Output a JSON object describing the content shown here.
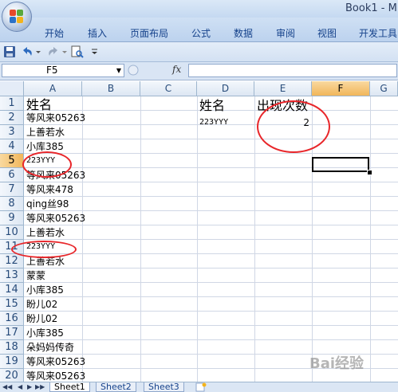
{
  "window": {
    "title": "Book1 - M"
  },
  "ribbon": {
    "tabs": [
      "开始",
      "插入",
      "页面布局",
      "公式",
      "数据",
      "审阅",
      "视图",
      "开发工具"
    ]
  },
  "formula_bar": {
    "name_box": "F5",
    "fx": "fx",
    "content": ""
  },
  "columns": [
    "A",
    "B",
    "C",
    "D",
    "E",
    "F",
    "G"
  ],
  "rows": [
    "1",
    "2",
    "3",
    "4",
    "5",
    "6",
    "7",
    "8",
    "9",
    "10",
    "11",
    "12",
    "13",
    "14",
    "15",
    "16",
    "17",
    "18",
    "19",
    "20"
  ],
  "cells": {
    "A": [
      "姓名",
      "等风来05263",
      "上善若水",
      "小库385",
      "223YYY",
      "等风来05263",
      "等风来478",
      "qing丝98",
      "等风来05263",
      "上善若水",
      "223YYY",
      "上善若水",
      "蒙蒙",
      "小库385",
      "盼儿02",
      "盼儿02",
      "小库385",
      "朵妈妈传奇",
      "等风来05263",
      "等风来05263"
    ],
    "D1": "姓名",
    "D2": "223YYY",
    "E1": "出现次数",
    "E2": "2"
  },
  "selection": {
    "cell": "F5",
    "active_column": "F",
    "active_row": "5"
  },
  "sheets": [
    "Sheet1",
    "Sheet2",
    "Sheet3"
  ],
  "active_sheet": "Sheet1",
  "watermark": "Bai经验",
  "colors": {
    "annotation_circle": "#e8262a",
    "ribbon_text": "#15428b",
    "header_active": "#f1b65a"
  }
}
